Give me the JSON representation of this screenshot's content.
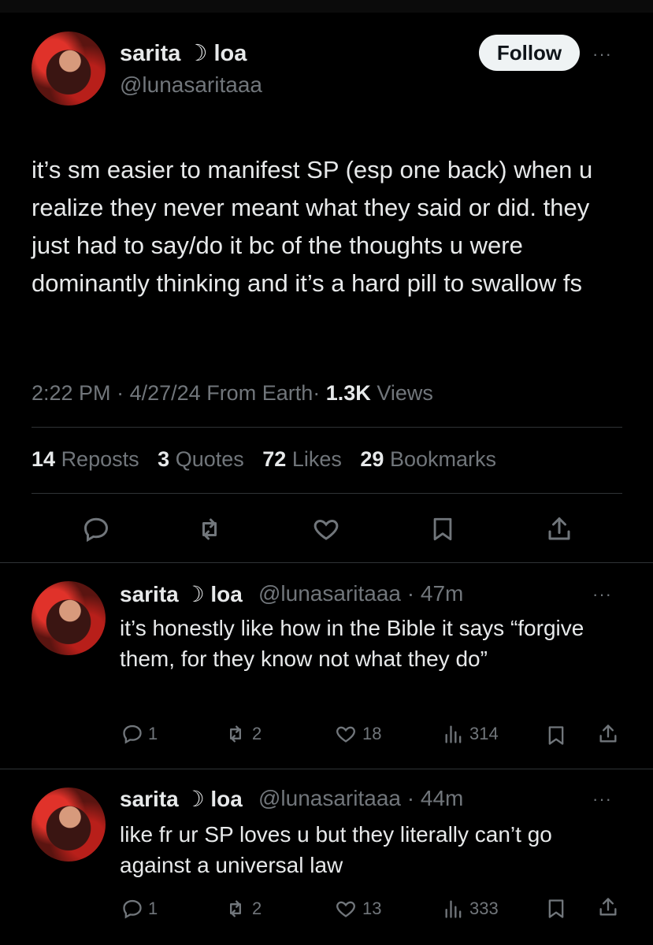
{
  "main_tweet": {
    "display_name": "sarita ☽ loa",
    "handle": "@lunasaritaaa",
    "follow_label": "Follow",
    "more_label": "···",
    "text": "it’s sm easier to manifest SP (esp one back) when u realize they never meant what they said or did. they just had to say/do it bc of the thoughts u were dominantly thinking and it’s a hard pill to swallow fs",
    "time": "2:22 PM",
    "date": "4/27/24",
    "location": "From Earth",
    "views_count": "1.3K",
    "views_label": "Views",
    "sep": "·",
    "stats": [
      {
        "count": "14",
        "label": "Reposts"
      },
      {
        "count": "3",
        "label": "Quotes"
      },
      {
        "count": "72",
        "label": "Likes"
      },
      {
        "count": "29",
        "label": "Bookmarks"
      }
    ],
    "actions": [
      "reply-icon",
      "repost-icon",
      "like-icon",
      "bookmark-icon",
      "share-icon"
    ]
  },
  "replies": [
    {
      "display_name": "sarita ☽ loa",
      "handle": "@lunasaritaaa",
      "time": "47m",
      "text": "it’s honestly like how in the Bible it says “forgive them, for they know not what they do”",
      "reply_count": "1",
      "repost_count": "2",
      "like_count": "18",
      "view_count": "314"
    },
    {
      "display_name": "sarita ☽ loa",
      "handle": "@lunasaritaaa",
      "time": "44m",
      "text": "like fr ur SP loves u but they literally can’t go against a universal law",
      "reply_count": "1",
      "repost_count": "2",
      "like_count": "13",
      "view_count": "333"
    }
  ],
  "colors": {
    "background": "#000000",
    "text": "#e7e9ea",
    "secondary": "#71767b",
    "divider": "#2f3336",
    "follow_bg": "#eff3f4"
  }
}
